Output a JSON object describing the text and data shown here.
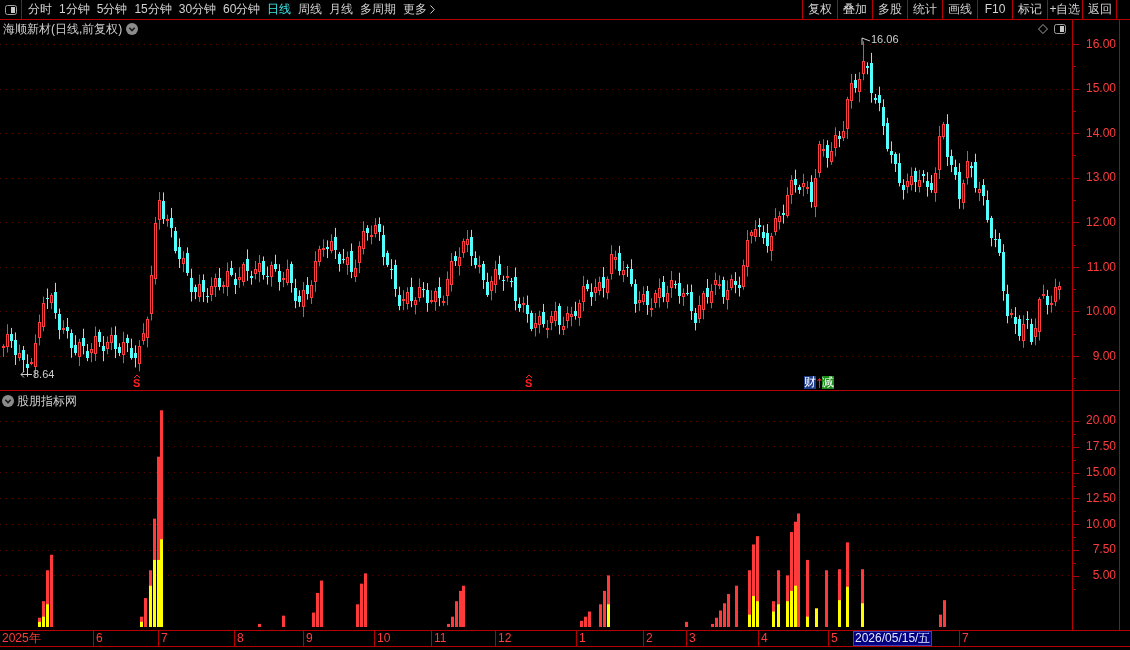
{
  "toolbar": {
    "periods": [
      {
        "label": "分时",
        "kind": "period",
        "selected": false
      },
      {
        "label": "1分钟",
        "kind": "period",
        "selected": false
      },
      {
        "label": "5分钟",
        "kind": "period",
        "selected": false
      },
      {
        "label": "15分钟",
        "kind": "period",
        "selected": false
      },
      {
        "label": "30分钟",
        "kind": "period",
        "selected": false
      },
      {
        "label": "60分钟",
        "kind": "period",
        "selected": false
      },
      {
        "label": "日线",
        "kind": "period",
        "selected": true
      },
      {
        "label": "周线",
        "kind": "period",
        "selected": false
      },
      {
        "label": "月线",
        "kind": "period",
        "selected": false
      },
      {
        "label": "多周期",
        "kind": "period",
        "selected": false
      },
      {
        "label": "更多",
        "kind": "menu",
        "selected": false
      }
    ],
    "buttons": [
      "复权",
      "叠加",
      "多股",
      "统计",
      "画线",
      "F10",
      "标记",
      "+自选",
      "返回"
    ]
  },
  "price_panel": {
    "title": "海顺新材(日线,前复权)",
    "high_label": "16.06",
    "low_label": "8.64",
    "markers": [
      {
        "kind": "signal",
        "text": "S"
      },
      {
        "kind": "signal",
        "text": "S"
      },
      {
        "kind": "tag",
        "text": "财",
        "color": "#1e3c8c"
      },
      {
        "kind": "arrow"
      },
      {
        "kind": "tag",
        "text": "减",
        "color": "#1a8c1a"
      }
    ],
    "axis": [
      "16.00",
      "15.00",
      "14.00",
      "13.00",
      "12.00",
      "11.00",
      "10.00",
      "9.00"
    ]
  },
  "indicator_panel": {
    "title": "股朋指标网",
    "axis": [
      "20.00",
      "17.50",
      "15.00",
      "12.50",
      "10.00",
      "7.50",
      "5.00"
    ]
  },
  "time_axis": [
    {
      "kind": "month",
      "label": "2025年"
    },
    {
      "kind": "month",
      "label": "6"
    },
    {
      "kind": "month",
      "label": "7"
    },
    {
      "kind": "month",
      "label": "8"
    },
    {
      "kind": "month",
      "label": "9"
    },
    {
      "kind": "month",
      "label": "10"
    },
    {
      "kind": "month",
      "label": "11"
    },
    {
      "kind": "month",
      "label": "12"
    },
    {
      "kind": "month",
      "label": "1"
    },
    {
      "kind": "month",
      "label": "2"
    },
    {
      "kind": "month",
      "label": "3"
    },
    {
      "kind": "month",
      "label": "4"
    },
    {
      "kind": "month",
      "label": "5"
    },
    {
      "kind": "cursor",
      "label": "2026/05/15/五"
    },
    {
      "kind": "month",
      "label": "7"
    }
  ]
}
